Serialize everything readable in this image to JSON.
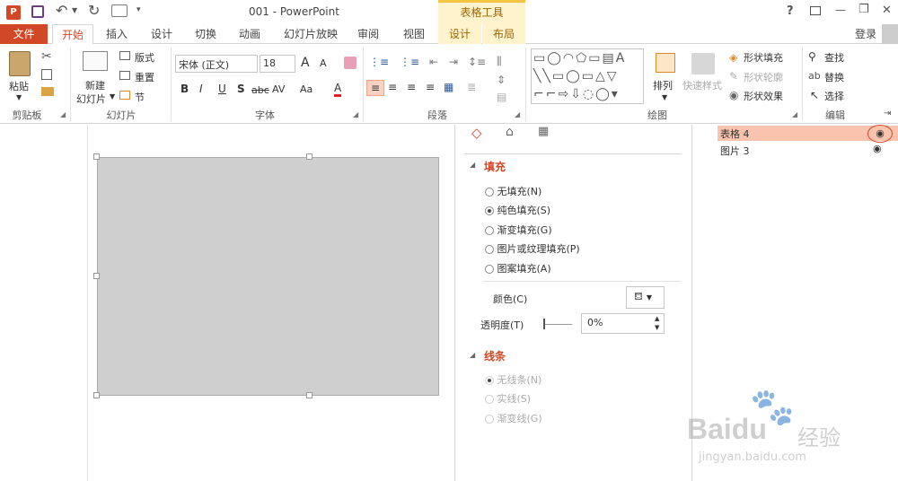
{
  "title": {
    "doc": "001 - PowerPoint",
    "context_group": "表格工具",
    "help": "?",
    "minimize": "—",
    "restore": "❐",
    "close": "✕"
  },
  "tabs": {
    "file": "文件",
    "home": "开始",
    "insert": "插入",
    "design": "设计",
    "transitions": "切换",
    "animations": "动画",
    "slideshow": "幻灯片放映",
    "review": "审阅",
    "view": "视图",
    "table_design": "设计",
    "table_layout": "布局",
    "login": "登录"
  },
  "ribbon": {
    "clipboard": {
      "label": "剪贴板",
      "paste": "粘贴"
    },
    "slides": {
      "label": "幻灯片",
      "new_slide_line1": "新建",
      "new_slide_line2": "幻灯片",
      "layout": "版式",
      "reset": "重置",
      "section": "节"
    },
    "font": {
      "label": "字体",
      "font_name": "宋体 (正文)",
      "font_size": "18",
      "grow": "A",
      "shrink": "A",
      "bold": "B",
      "italic": "I",
      "underline": "U",
      "shadow": "S",
      "strike": "abc",
      "spacing": "AV",
      "case": "Aa",
      "color": "A"
    },
    "paragraph": {
      "label": "段落"
    },
    "drawing": {
      "label": "绘图",
      "arrange": "排列",
      "quick_styles": "快速样式",
      "shape_fill": "形状填充",
      "shape_outline": "形状轮廓",
      "shape_effects": "形状效果"
    },
    "editing": {
      "label": "编辑",
      "find": "查找",
      "replace": "替换",
      "select": "选择"
    }
  },
  "format_pane": {
    "fill_header": "填充",
    "fill_options": [
      {
        "label": "无填充(N)",
        "checked": false
      },
      {
        "label": "纯色填充(S)",
        "checked": true
      },
      {
        "label": "渐变填充(G)",
        "checked": false
      },
      {
        "label": "图片或纹理填充(P)",
        "checked": false
      },
      {
        "label": "图案填充(A)",
        "checked": false
      }
    ],
    "color_label": "颜色(C)",
    "transparency_label": "透明度(T)",
    "transparency_value": "0%",
    "line_header": "线条",
    "line_options": [
      {
        "label": "无线条(N)",
        "checked": true
      },
      {
        "label": "实线(S)",
        "checked": false
      },
      {
        "label": "渐变线(G)",
        "checked": false
      }
    ]
  },
  "selection_pane": {
    "items": [
      {
        "label": "表格 4",
        "selected": true
      },
      {
        "label": "图片 3",
        "selected": false
      }
    ]
  },
  "watermark": {
    "brand": "Bai",
    "brand2": "du",
    "cn": "经验",
    "url": "jingyan.baidu.com"
  },
  "colors": {
    "accent": "#d24726",
    "selected_row": "#f9c3ad",
    "table_fill": "#d0cfcf",
    "context_tab": "#fef3cd"
  }
}
